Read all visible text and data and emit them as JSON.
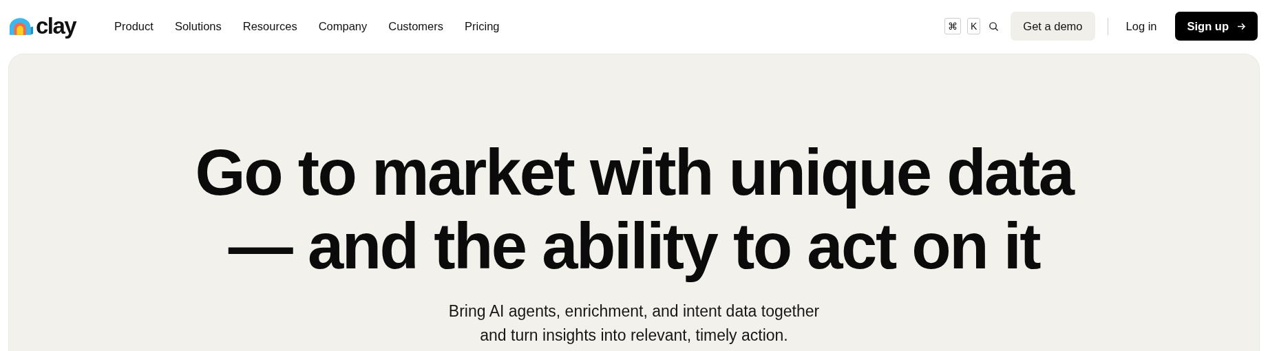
{
  "logo": {
    "text": "clay"
  },
  "nav": [
    {
      "label": "Product"
    },
    {
      "label": "Solutions"
    },
    {
      "label": "Resources"
    },
    {
      "label": "Company"
    },
    {
      "label": "Customers"
    },
    {
      "label": "Pricing"
    }
  ],
  "search_shortcut": {
    "keys": [
      "⌘",
      "K"
    ]
  },
  "buttons": [
    {
      "kind": "secondary",
      "label": "Get a demo"
    },
    {
      "kind": "link",
      "label": "Log in"
    },
    {
      "kind": "primary",
      "label": "Sign up"
    }
  ],
  "hero": {
    "headline": [
      "Go to market with unique data",
      "— and the ability to act on it"
    ],
    "subtitle": [
      "Bring AI agents, enrichment, and intent data together",
      "and turn insights into relevant, timely action."
    ]
  }
}
